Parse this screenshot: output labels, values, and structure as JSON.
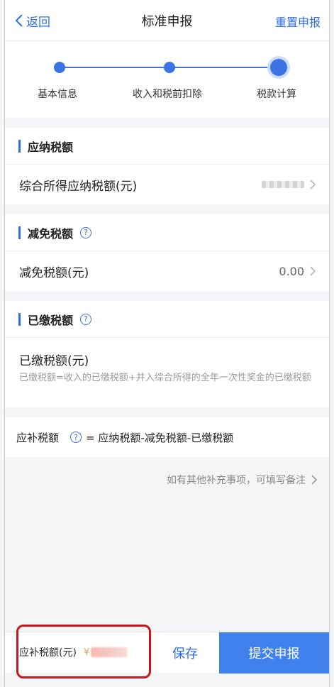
{
  "header": {
    "back_label": "返回",
    "title": "标准申报",
    "reset_label": "重置申报"
  },
  "steps": [
    "基本信息",
    "收入和税前扣除",
    "税款计算"
  ],
  "sections": {
    "payable": {
      "title": "应纳税额",
      "row_label": "综合所得应纳税额(元)"
    },
    "reduction": {
      "title": "减免税额",
      "row_label": "减免税额(元)",
      "row_value": "0.00"
    },
    "paid": {
      "title": "已缴税额",
      "row_label": "已缴税额(元)",
      "note": "已缴税额=收入的已缴税额+并入综合所得的全年一次性奖金的已缴税额"
    }
  },
  "formula": {
    "label": "应补税额",
    "expression": "= 应纳税额-减免税额-已缴税额"
  },
  "remark": "如有其他补充事项，可填写备注",
  "bottom": {
    "due_label": "应补税额(元)",
    "currency": "¥",
    "save_label": "保存",
    "submit_label": "提交申报"
  },
  "colors": {
    "accent": "#2e6fe3",
    "submit_bg": "#4181ee",
    "highlight": "#c9161b"
  }
}
